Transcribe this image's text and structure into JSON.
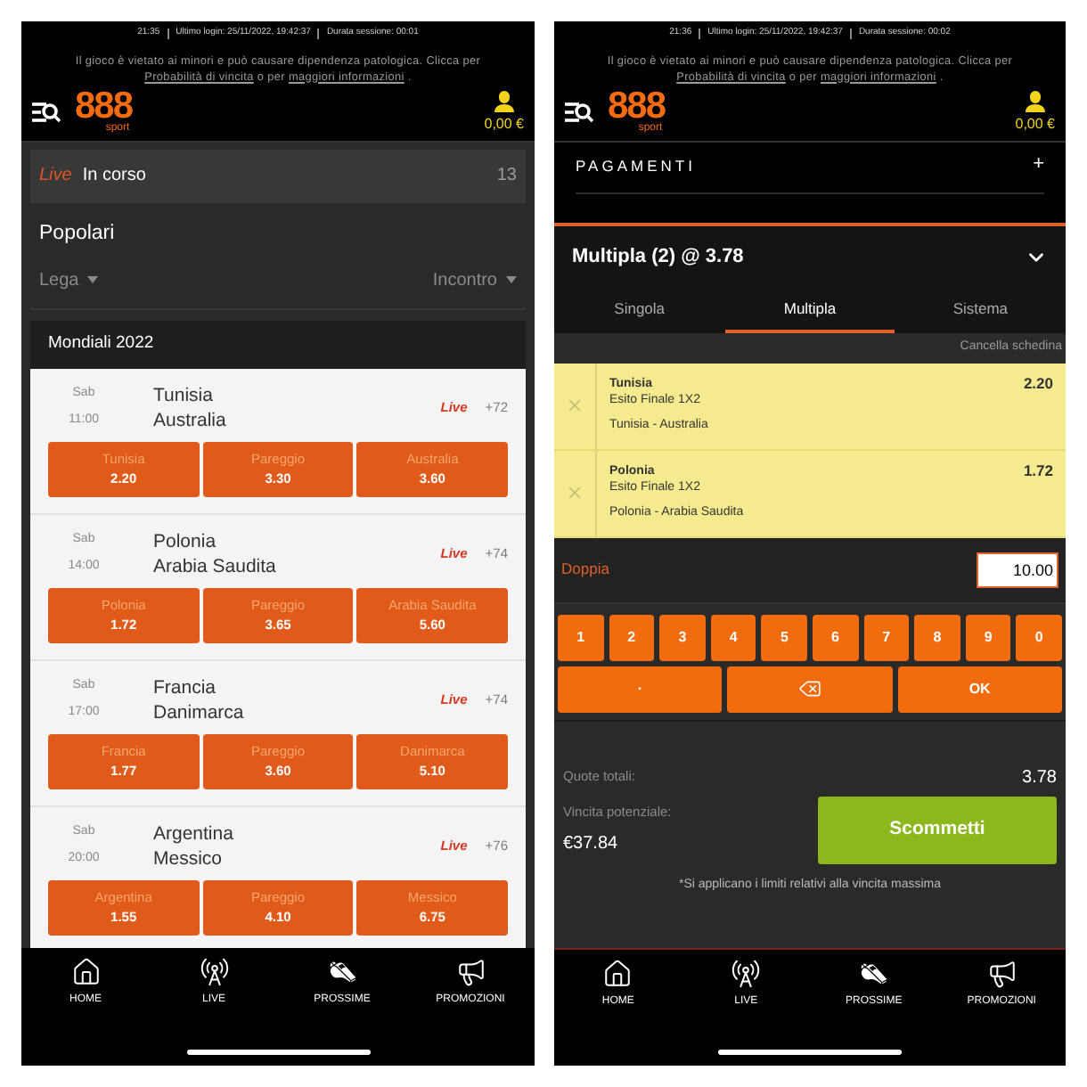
{
  "home_screen": {
    "status": {
      "time": "21:35",
      "last_login": "Ultimo login: 25/11/2022, 19:42:37",
      "session": "Durata sessione: 00:01"
    },
    "notice": {
      "text": "Il gioco è vietato ai minori e può causare dipendenza patologica. Clicca per",
      "link_1": "Probabilità di vincita",
      "middle": "o per",
      "link_2": "maggiori informazioni",
      "end": "."
    },
    "logo": {
      "digits": "888",
      "word": "sport"
    },
    "balance": "0,00 €",
    "live_bar": {
      "tag": "Live",
      "title": "In corso",
      "count": "13"
    },
    "section_title": "Popolari",
    "filters": [
      {
        "label": "Lega"
      },
      {
        "label": "Incontro"
      }
    ],
    "league": "Mondiali 2022",
    "matches": [
      {
        "day": "Sab",
        "time": "11:00",
        "home": "Tunisia",
        "away": "Australia",
        "live": "Live",
        "markets": "+72",
        "odds": [
          {
            "label": "Tunisia",
            "value": "2.20"
          },
          {
            "label": "Pareggio",
            "value": "3.30"
          },
          {
            "label": "Australia",
            "value": "3.60"
          }
        ]
      },
      {
        "day": "Sab",
        "time": "14:00",
        "home": "Polonia",
        "away": "Arabia Saudita",
        "live": "Live",
        "markets": "+74",
        "odds": [
          {
            "label": "Polonia",
            "value": "1.72"
          },
          {
            "label": "Pareggio",
            "value": "3.65"
          },
          {
            "label": "Arabia Saudita",
            "value": "5.60"
          }
        ]
      },
      {
        "day": "Sab",
        "time": "17:00",
        "home": "Francia",
        "away": "Danimarca",
        "live": "Live",
        "markets": "+74",
        "odds": [
          {
            "label": "Francia",
            "value": "1.77"
          },
          {
            "label": "Pareggio",
            "value": "3.60"
          },
          {
            "label": "Danimarca",
            "value": "5.10"
          }
        ]
      },
      {
        "day": "Sab",
        "time": "20:00",
        "home": "Argentina",
        "away": "Messico",
        "live": "Live",
        "markets": "+76",
        "odds": [
          {
            "label": "Argentina",
            "value": "1.55"
          },
          {
            "label": "Pareggio",
            "value": "4.10"
          },
          {
            "label": "Messico",
            "value": "6.75"
          }
        ]
      }
    ],
    "nav": [
      {
        "kind": "home",
        "label": "HOME"
      },
      {
        "kind": "live",
        "label": "LIVE"
      },
      {
        "kind": "next",
        "label": "PROSSIME"
      },
      {
        "kind": "promo",
        "label": "PROMOZIONI"
      }
    ]
  },
  "betslip_screen": {
    "status": {
      "time": "21:36",
      "last_login": "Ultimo login: 25/11/2022, 19:42:37",
      "session": "Durata sessione: 00:02"
    },
    "notice": {
      "text": "Il gioco è vietato ai minori e può causare dipendenza patologica. Clicca per",
      "link_1": "Probabilità di vincita",
      "middle": "o per",
      "link_2": "maggiori informazioni",
      "end": "."
    },
    "logo": {
      "digits": "888",
      "word": "sport"
    },
    "balance": "0,00 €",
    "payments": {
      "label": "PAGAMENTI",
      "toggle": "+"
    },
    "slip_title": "Multipla (2) @ 3.78",
    "tabs": [
      {
        "label": "Singola",
        "selected": false
      },
      {
        "label": "Multipla",
        "selected": true
      },
      {
        "label": "Sistema",
        "selected": false
      }
    ],
    "clear": "Cancella schedina",
    "selections": [
      {
        "pick": "Tunisia",
        "market": "Esito Finale 1X2",
        "event": "Tunisia - Australia",
        "odds": "2.20"
      },
      {
        "pick": "Polonia",
        "market": "Esito Finale 1X2",
        "event": "Polonia - Arabia Saudita",
        "odds": "1.72"
      }
    ],
    "stake": {
      "label": "Doppia",
      "value": "10.00"
    },
    "keys": [
      {
        "kind": "digit",
        "label": "1"
      },
      {
        "kind": "digit",
        "label": "2"
      },
      {
        "kind": "digit",
        "label": "3"
      },
      {
        "kind": "digit",
        "label": "4"
      },
      {
        "kind": "digit",
        "label": "5"
      },
      {
        "kind": "digit",
        "label": "6"
      },
      {
        "kind": "digit",
        "label": "7"
      },
      {
        "kind": "digit",
        "label": "8"
      },
      {
        "kind": "digit",
        "label": "9"
      },
      {
        "kind": "digit",
        "label": "0"
      },
      {
        "kind": "wide",
        "label": "·"
      },
      {
        "kind": "backspace"
      },
      {
        "kind": "wide",
        "label": "OK"
      }
    ],
    "total": {
      "label": "Quote totali:",
      "value": "3.78"
    },
    "potential": {
      "label": "Vincita potenziale:",
      "value": "€37.84"
    },
    "bet_button": "Scommetti",
    "disclaimer": "*Si applicano i limiti relativi alla vincita massima",
    "nav": [
      {
        "kind": "home",
        "label": "HOME"
      },
      {
        "kind": "live",
        "label": "LIVE"
      },
      {
        "kind": "next",
        "label": "PROSSIME"
      },
      {
        "kind": "promo",
        "label": "PROMOZIONI"
      }
    ]
  }
}
